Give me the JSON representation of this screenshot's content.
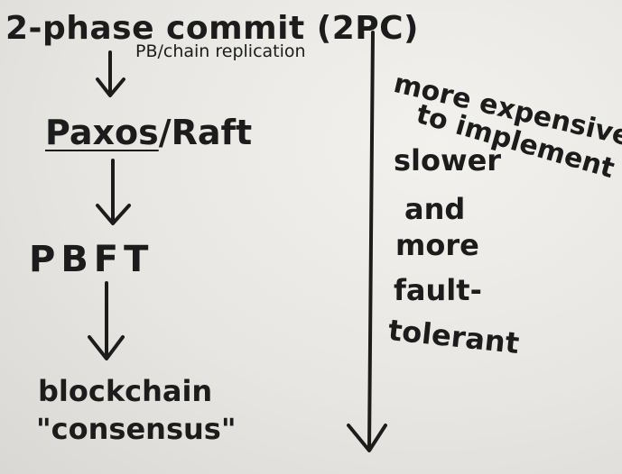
{
  "diagram": {
    "nodes": [
      {
        "id": "two_pc",
        "label": "2-phase commit (2PC)"
      },
      {
        "id": "paxos_raft",
        "label_a": "Paxos",
        "label_sep": "/",
        "label_b": "Raft"
      },
      {
        "id": "pbft",
        "label": "PBFT"
      },
      {
        "id": "blockchain",
        "label_line1": "blockchain",
        "label_line2": "\"consensus\""
      }
    ],
    "edges": [
      {
        "from": "two_pc",
        "to": "paxos_raft",
        "label": "PB/chain replication"
      },
      {
        "from": "paxos_raft",
        "to": "pbft",
        "label": ""
      },
      {
        "from": "pbft",
        "to": "blockchain",
        "label": ""
      }
    ],
    "side_note": {
      "lines": [
        "more expensive",
        "to implement",
        "slower",
        "and",
        "more",
        "fault-",
        "tolerant"
      ]
    },
    "ink_color": "#1c1c1c",
    "board_color": "#e9e8e4"
  }
}
